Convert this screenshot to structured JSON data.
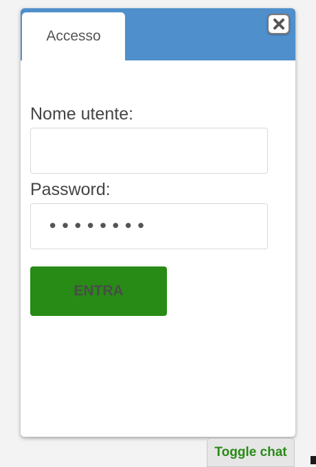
{
  "login_panel": {
    "tab_label": "Accesso",
    "username_label": "Nome utente:",
    "username_value": "",
    "password_label": "Password:",
    "password_value": "••••••••",
    "submit_label": "ENTRA"
  },
  "close_icon": "close-icon",
  "toggle_chat_label": "Toggle chat",
  "colors": {
    "header_bar": "#4f8fcb",
    "submit_button": "#278b15",
    "toggle_chat_text": "#278b15",
    "panel_background": "#ffffff"
  }
}
